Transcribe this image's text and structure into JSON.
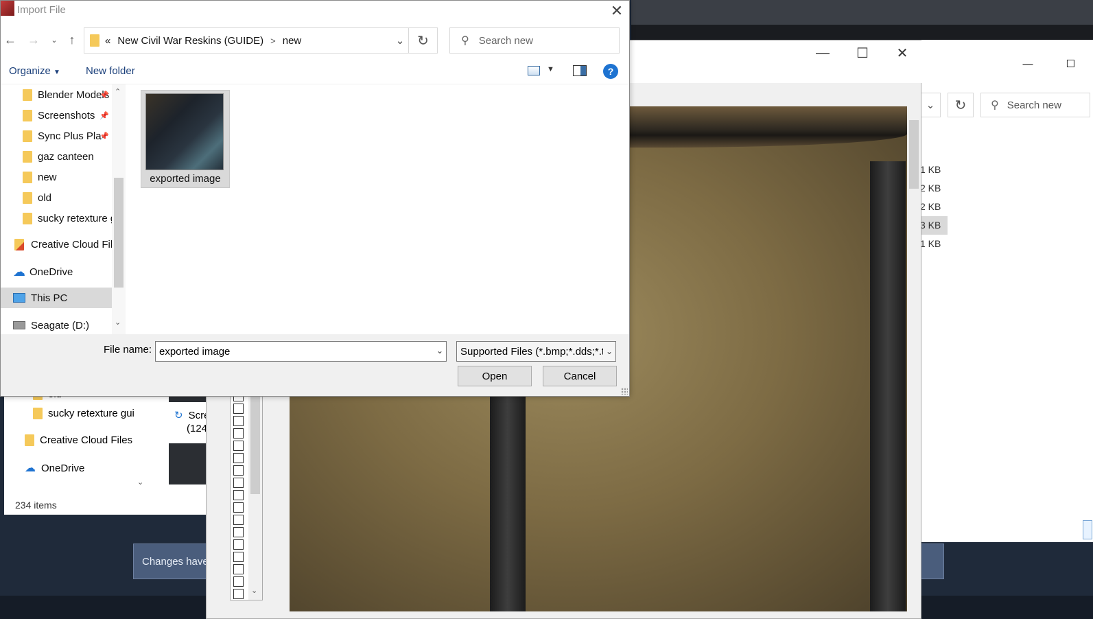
{
  "dialog": {
    "title": "Import File",
    "address": {
      "chevrons": "«",
      "crumbs": [
        "New Civil War Reskins (GUIDE)",
        "new"
      ],
      "separator": ">"
    },
    "search_placeholder": "Search new",
    "toolbar": {
      "organize": "Organize",
      "new_folder": "New folder"
    },
    "nav_items": [
      {
        "label": "Blender Models",
        "pinned": true,
        "icon": "folder-icon"
      },
      {
        "label": "Screenshots",
        "pinned": true,
        "icon": "folder-icon"
      },
      {
        "label": "Sync Plus Pla",
        "pinned": true,
        "icon": "sync-folder-icon"
      },
      {
        "label": "gaz canteen",
        "pinned": false,
        "icon": "folder-icon"
      },
      {
        "label": "new",
        "pinned": false,
        "icon": "folder-icon"
      },
      {
        "label": "old",
        "pinned": false,
        "icon": "folder-icon"
      },
      {
        "label": "sucky retexture g",
        "pinned": false,
        "icon": "folder-icon"
      },
      {
        "label": "Creative Cloud Fil",
        "pinned": false,
        "icon": "creative-cloud-icon"
      },
      {
        "label": "OneDrive",
        "pinned": false,
        "icon": "onedrive-icon"
      },
      {
        "label": "This PC",
        "pinned": false,
        "icon": "computer-icon",
        "selected": true
      },
      {
        "label": "Seagate (D:)",
        "pinned": false,
        "icon": "drive-icon"
      }
    ],
    "files": [
      {
        "name": "exported image",
        "selected": true
      }
    ],
    "filename_label": "File name:",
    "filename_value": "exported image",
    "filetype_value": "Supported Files (*.bmp;*.dds;*.t",
    "open_label": "Open",
    "cancel_label": "Cancel"
  },
  "explorer_right": {
    "search_placeholder": "Search new",
    "sizes": [
      "1 KB",
      "2 KB",
      "2 KB",
      "3 KB",
      "1 KB"
    ]
  },
  "explorer_mid": {
    "items": [
      "old",
      "sucky retexture gui",
      "Creative Cloud Files",
      "OneDrive"
    ],
    "thumb_labels": [
      "Scre",
      "(124"
    ],
    "status": "234 items"
  },
  "banner": {
    "text": "Changes have"
  },
  "colors": {
    "accent": "#1e73d1",
    "folder": "#f5c95a",
    "selection": "#d9d9d9",
    "banner": "#4a5d7c"
  }
}
